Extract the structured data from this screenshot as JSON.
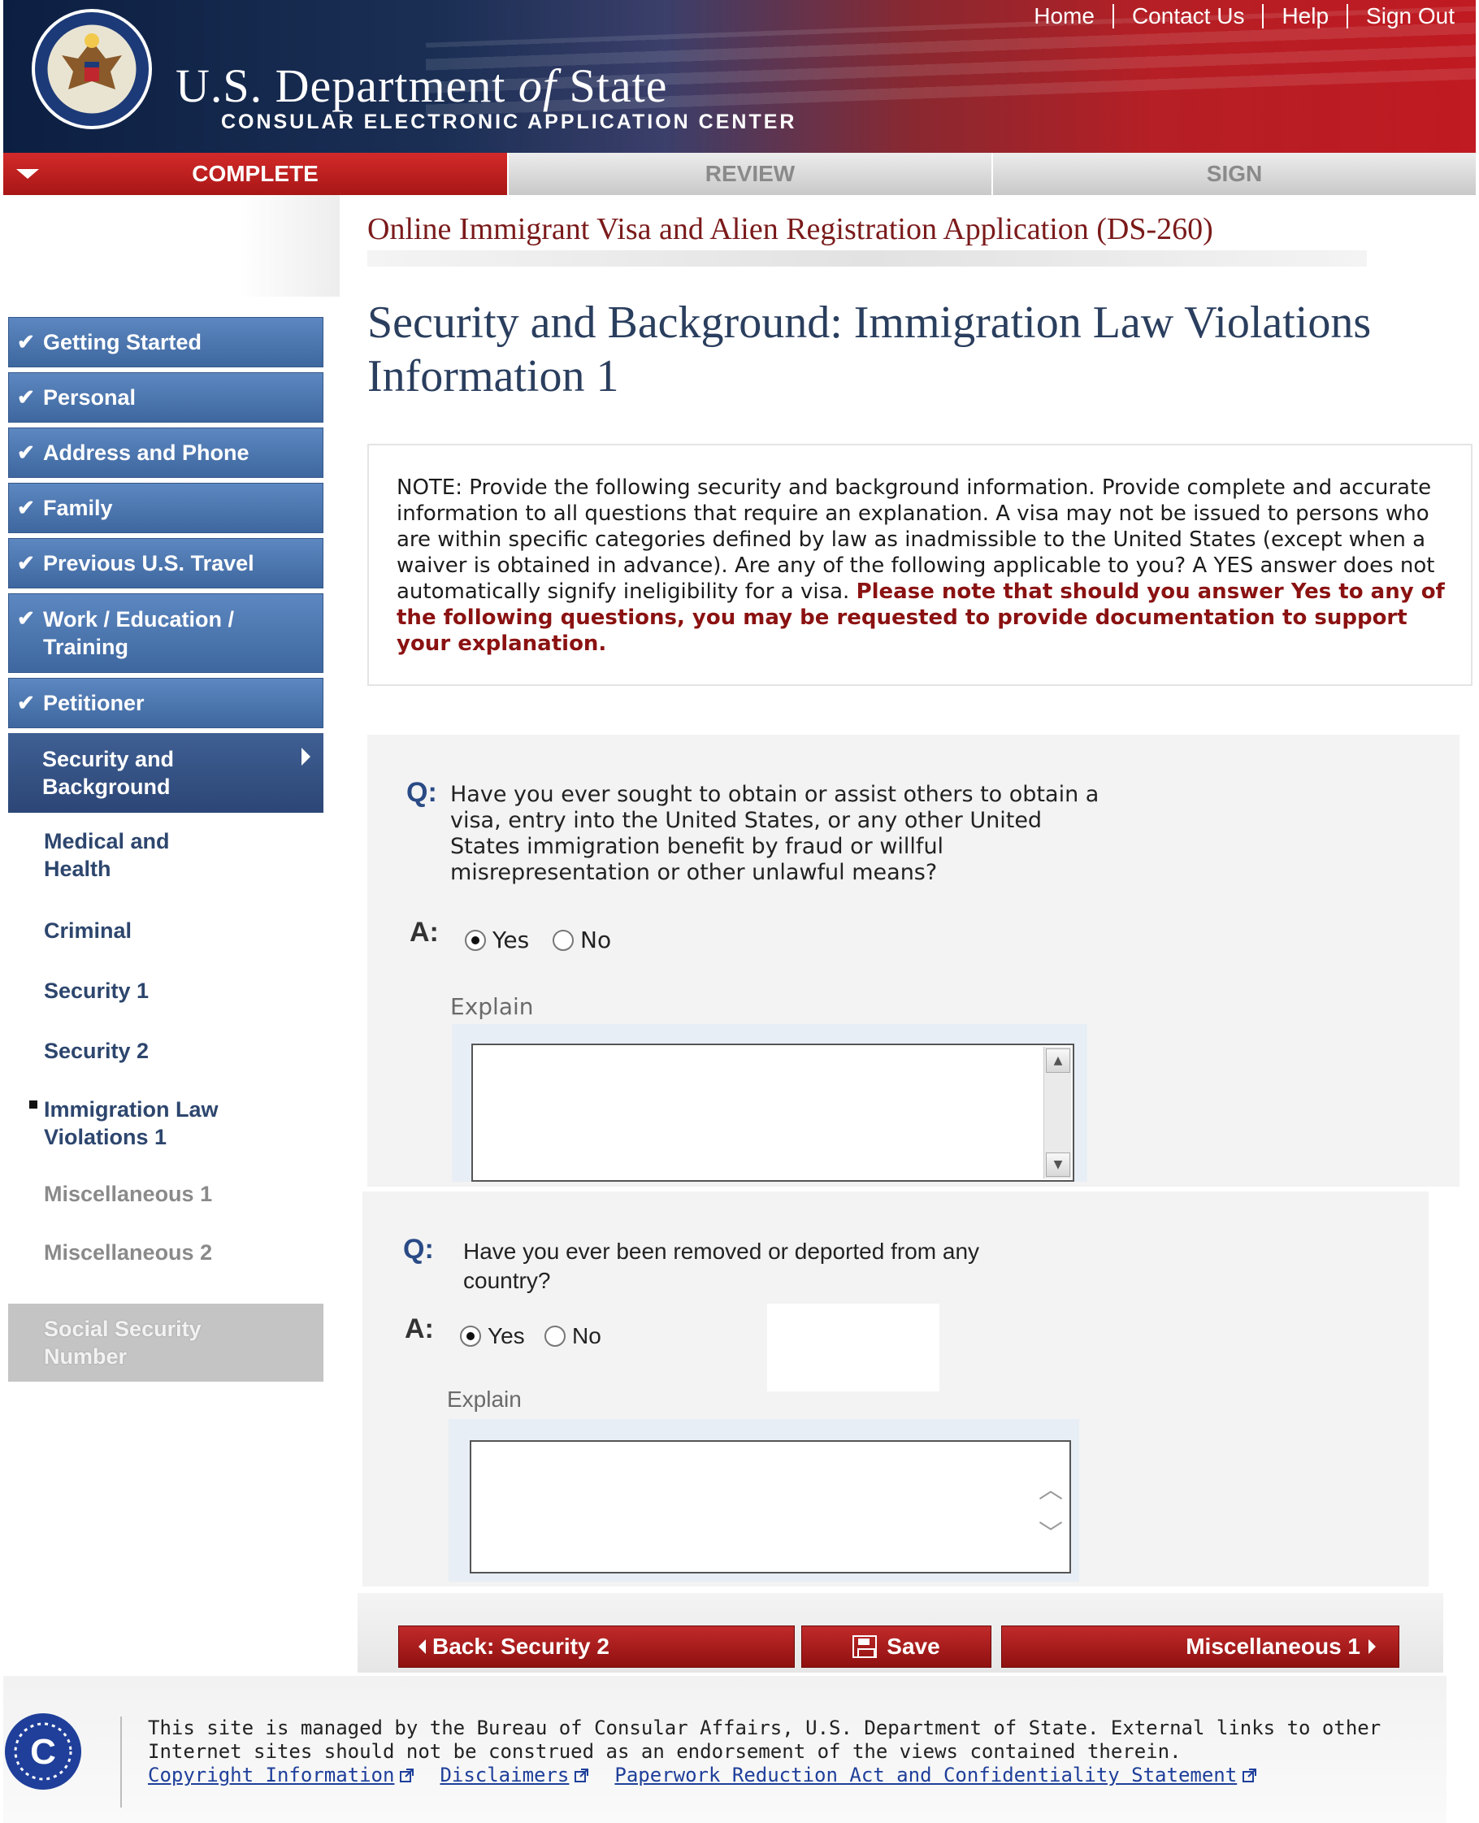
{
  "header": {
    "nav": [
      "Home",
      "Contact Us",
      "Help",
      "Sign Out"
    ],
    "title_main": "U.S. Department ",
    "title_of": "of",
    "title_state": " State",
    "subtitle": "CONSULAR ELECTRONIC APPLICATION CENTER",
    "colors": {
      "navy": "#0c1f42",
      "red": "#c01a22"
    }
  },
  "progress_tabs": [
    {
      "label": "COMPLETE",
      "state": "current"
    },
    {
      "label": "REVIEW",
      "state": "inactive"
    },
    {
      "label": "SIGN",
      "state": "inactive"
    }
  ],
  "app_title": "Online Immigrant Visa and Alien Registration Application (DS-260)",
  "page_title": "Security and Background: Immigration Law Violations Information 1",
  "sidebar": {
    "items": [
      {
        "label": "Getting Started",
        "state": "done"
      },
      {
        "label": "Personal",
        "state": "done"
      },
      {
        "label": "Address and Phone",
        "state": "done"
      },
      {
        "label": "Family",
        "state": "done"
      },
      {
        "label": "Previous U.S. Travel",
        "state": "done"
      },
      {
        "label": "Work / Education / Training",
        "state": "done"
      },
      {
        "label": "Petitioner",
        "state": "done"
      },
      {
        "label": "Security and Background",
        "state": "active"
      },
      {
        "label": "Medical and Health",
        "state": "pending"
      },
      {
        "label": "Criminal",
        "state": "pending"
      },
      {
        "label": "Security 1",
        "state": "pending"
      },
      {
        "label": "Security 2",
        "state": "pending"
      },
      {
        "label": "Immigration Law Violations 1",
        "state": "current-sub"
      },
      {
        "label": "Miscellaneous 1",
        "state": "future"
      },
      {
        "label": "Miscellaneous 2",
        "state": "future"
      },
      {
        "label": "Social Security Number",
        "state": "disabled"
      }
    ]
  },
  "note": {
    "text": "NOTE: Provide the following security and background information. Provide complete and accurate information to all questions that require an explanation. A visa may not be issued to persons who are within specific categories defined by law as inadmissible to the United States (except when a waiver is obtained in advance). Are any of the following applicable to you? A YES answer does not automatically signify ineligibility for a visa. ",
    "emphasis": "Please note that should you answer Yes to any of the following questions, you may be requested to provide documentation to support your explanation."
  },
  "questions": [
    {
      "q_label": "Q:",
      "text": "Have you ever sought to obtain or assist others to obtain a visa, entry into the United States, or any other United States immigration benefit by fraud or willful misrepresentation or other unlawful means?",
      "a_label": "A:",
      "options": [
        "Yes",
        "No"
      ],
      "selected": "Yes",
      "explain_label": "Explain",
      "explain_value": ""
    },
    {
      "q_label": "Q:",
      "text": "Have you ever been removed or deported from any country?",
      "a_label": "A:",
      "options": [
        "Yes",
        "No"
      ],
      "selected": "Yes",
      "explain_label": "Explain",
      "explain_value": ""
    }
  ],
  "buttons": {
    "back": "Back: Security 2",
    "save": "Save",
    "next": "Miscellaneous 1"
  },
  "footer": {
    "text": "This site is managed by the Bureau of Consular Affairs, U.S. Department of State. External links to other Internet sites should not be construed as an endorsement of the views contained therein.",
    "links": [
      "Copyright Information",
      "Disclaimers",
      "Paperwork Reduction Act and Confidentiality Statement"
    ],
    "logo_letter": "C"
  }
}
